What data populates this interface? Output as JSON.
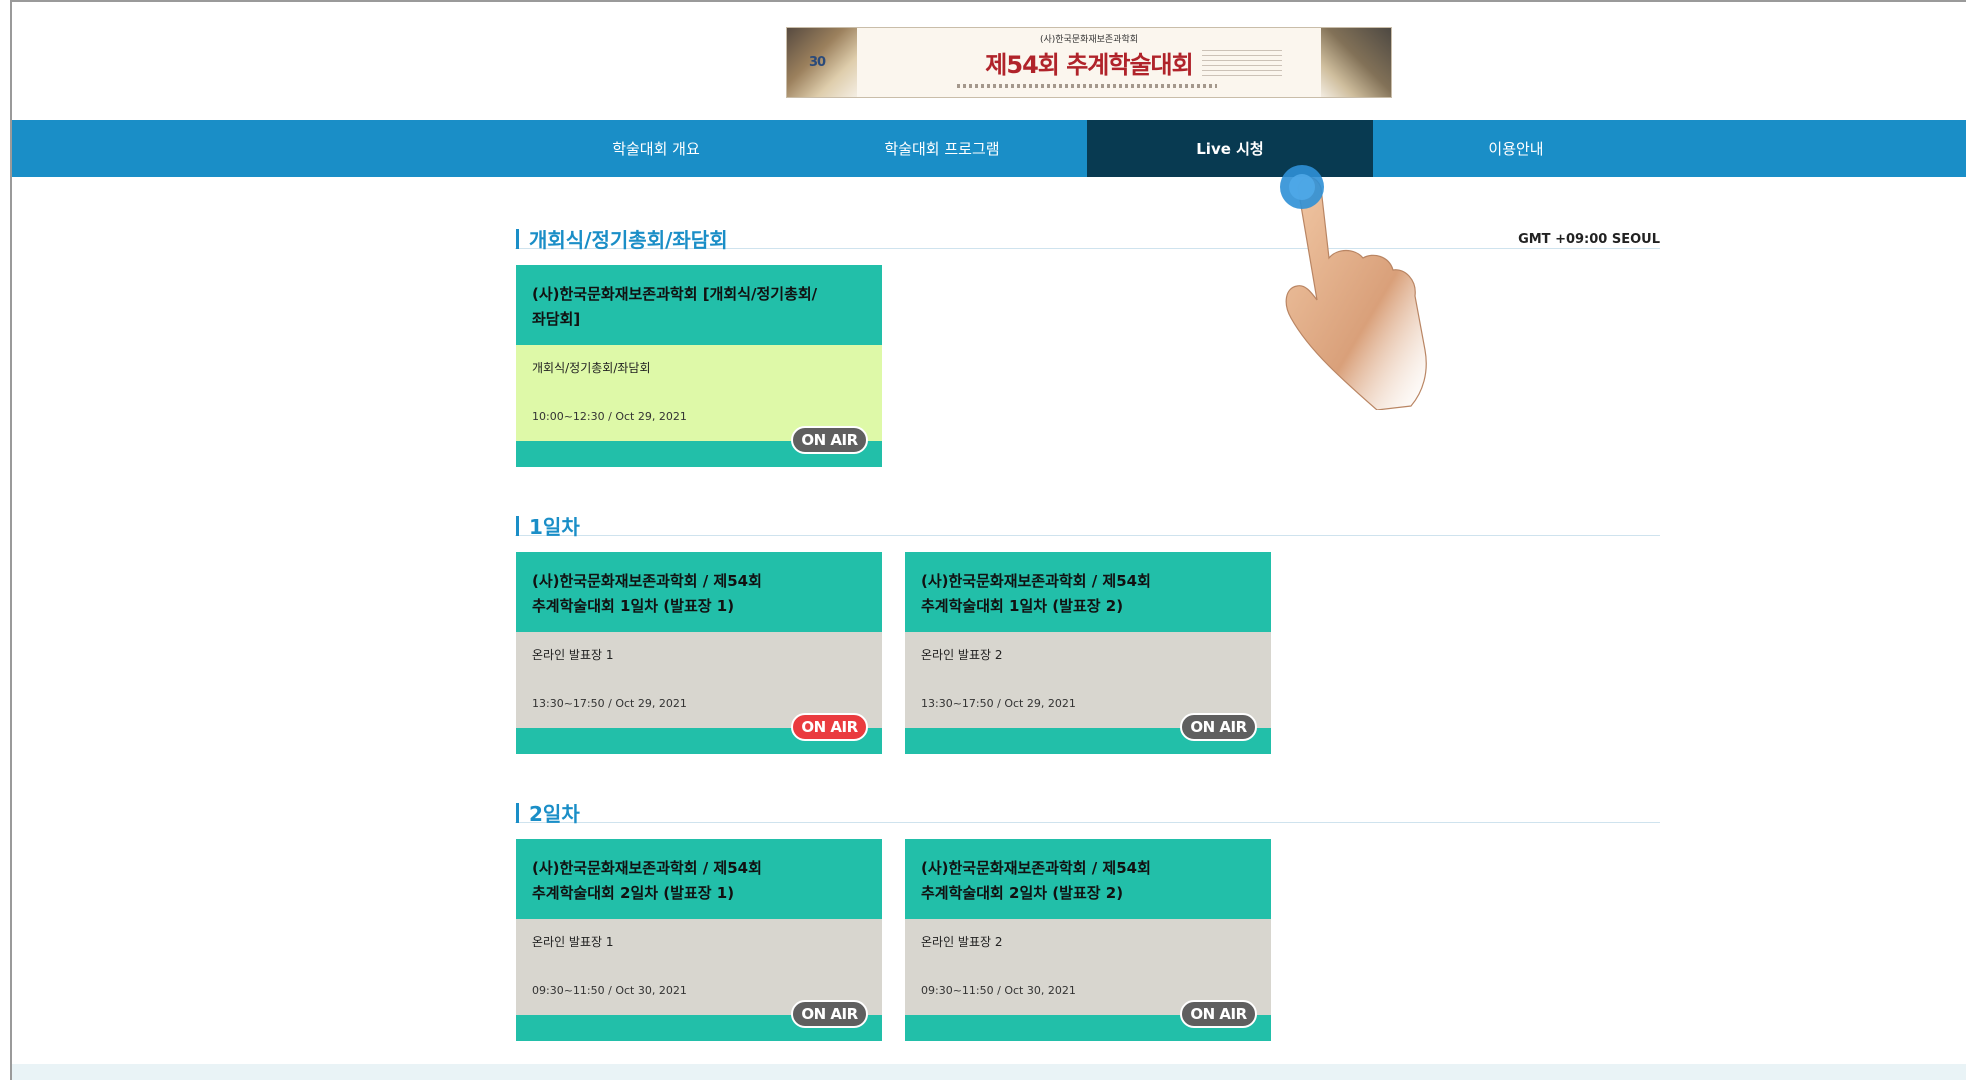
{
  "banner": {
    "small_title": "(사)한국문화재보존과학회",
    "big_title": "제54회 추계학술대회",
    "logo_text": "30"
  },
  "nav": {
    "items": [
      {
        "label": "학술대회 개요",
        "active": false
      },
      {
        "label": "학술대회 프로그램",
        "active": false
      },
      {
        "label": "Live 시청",
        "active": true
      },
      {
        "label": "이용안내",
        "active": false
      }
    ]
  },
  "timezone": "GMT +09:00 SEOUL",
  "sections": [
    {
      "title": "개회식/정기총회/좌담회",
      "cards": [
        {
          "title_line1": "(사)한국문화재보존과학회 [개회식/정기총회/",
          "title_line2": "좌담회]",
          "sub": "개회식/정기총회/좌담회",
          "time": "10:00~12:30 / Oct 29, 2021",
          "badge": "ON AIR",
          "badge_live": false
        }
      ]
    },
    {
      "title": "1일차",
      "cards": [
        {
          "title_line1": "(사)한국문화재보존과학회 / 제54회",
          "title_line2": "추계학술대회 1일차 (발표장 1)",
          "sub": "온라인 발표장 1",
          "time": "13:30~17:50 / Oct 29, 2021",
          "badge": "ON AIR",
          "badge_live": true
        },
        {
          "title_line1": "(사)한국문화재보존과학회 / 제54회",
          "title_line2": "추계학술대회 1일차 (발표장 2)",
          "sub": "온라인 발표장 2",
          "time": "13:30~17:50 / Oct 29, 2021",
          "badge": "ON AIR",
          "badge_live": false
        }
      ]
    },
    {
      "title": "2일차",
      "cards": [
        {
          "title_line1": "(사)한국문화재보존과학회 / 제54회",
          "title_line2": "추계학술대회 2일차 (발표장 1)",
          "sub": "온라인 발표장 1",
          "time": "09:30~11:50 / Oct 30, 2021",
          "badge": "ON AIR",
          "badge_live": false
        },
        {
          "title_line1": "(사)한국문화재보존과학회 / 제54회",
          "title_line2": "추계학술대회 2일차 (발표장 2)",
          "sub": "온라인 발표장 2",
          "time": "09:30~11:50 / Oct 30, 2021",
          "badge": "ON AIR",
          "badge_live": false
        }
      ]
    }
  ],
  "colors": {
    "nav_bg": "#1a8ec7",
    "nav_active": "#083a51",
    "card_teal": "#22bfa9",
    "card_body_gray": "#d8d6cf",
    "card_body_green": "#def9a8",
    "badge_live": "#ea3b3f",
    "badge_idle": "#5f5f5f",
    "section_title": "#1a8ec7"
  },
  "icons": {
    "pointer": "hand-pointer-icon"
  }
}
